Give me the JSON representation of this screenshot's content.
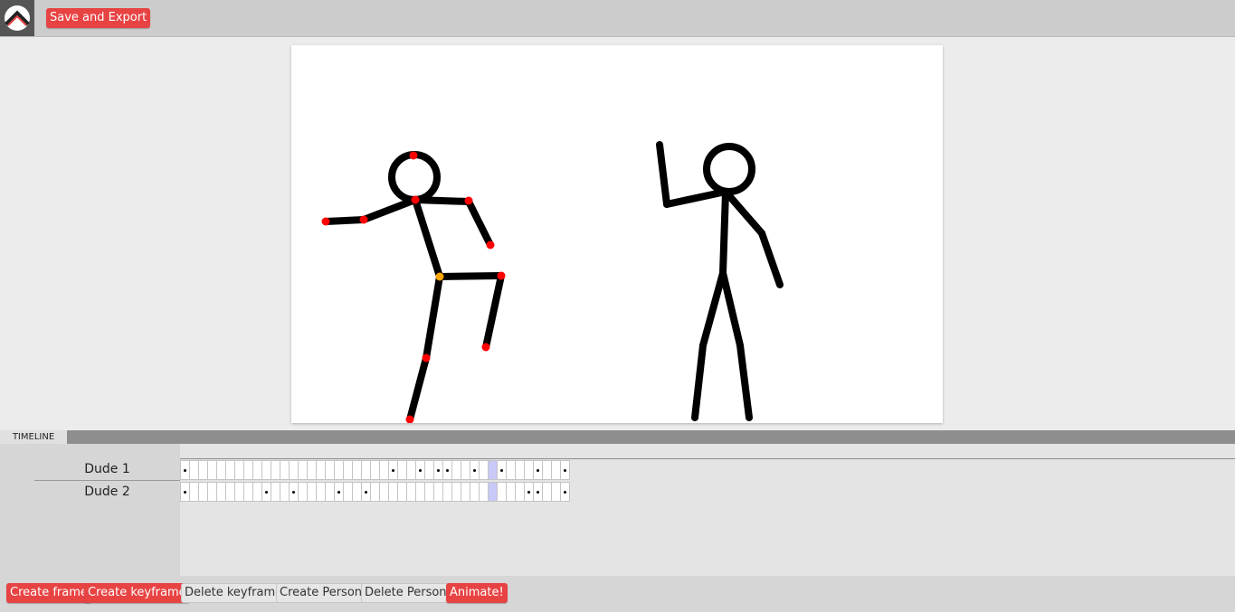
{
  "toolbar": {
    "save_export_label": "Save and Export"
  },
  "timeline": {
    "tab_label": "TIMELINE",
    "frame_count": 43,
    "selected_frame": 34,
    "people": [
      {
        "name": "Dude 1",
        "keyframes": [
          0,
          23,
          26,
          28,
          29,
          32,
          35,
          39,
          42
        ]
      },
      {
        "name": "Dude 2",
        "keyframes": [
          0,
          9,
          12,
          17,
          20,
          38,
          39,
          42
        ]
      }
    ]
  },
  "actions": {
    "create_frame": "Create frame",
    "create_keyframe": "Create keyframe",
    "delete_keyframe": "Delete keyframe",
    "create_person": "Create Person",
    "delete_person": "Delete Person",
    "animate": "Animate!"
  },
  "colors": {
    "accent_red": "#e84343",
    "joint_red": "#ff0000",
    "joint_orange": "#ffa500",
    "selected_frame": "#c9c9f7"
  }
}
